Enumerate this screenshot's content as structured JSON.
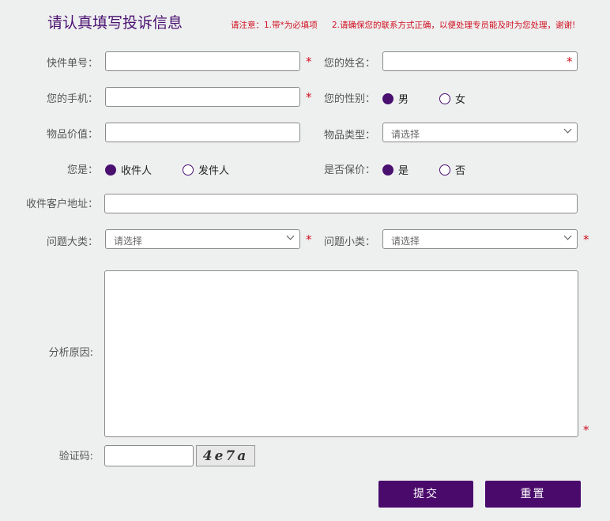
{
  "form": {
    "title": "请认真填写投诉信息",
    "notice1": "请注意：1.带*为必填项",
    "notice2": "2.请确保您的联系方式正确，以便处理专员能及时为您处理，谢谢!",
    "required_mark": "*",
    "fields": {
      "tracking_label": "快件单号：",
      "name_label": "您的姓名：",
      "phone_label": "您的手机：",
      "gender_label": "您的性别：",
      "gender_male": "男",
      "gender_female": "女",
      "gender_selected": "男",
      "value_label": "物品价值：",
      "type_label": "物品类型：",
      "type_value": "请选择",
      "role_label": "您是：",
      "role_receiver": "收件人",
      "role_sender": "发件人",
      "role_selected": "收件人",
      "insured_label": "是否保价：",
      "insured_yes": "是",
      "insured_no": "否",
      "insured_selected": "是",
      "address_label": "收件客户地址：",
      "issue_major_label": "问题大类：",
      "issue_major_value": "请选择",
      "issue_minor_label": "问题小类：",
      "issue_minor_value": "请选择",
      "reason_label": "分析原因:",
      "captcha_label": "验证码:",
      "captcha_text": "4e7a"
    },
    "buttons": {
      "submit": "提交",
      "reset": "重置"
    }
  },
  "colors": {
    "accent": "#4a0a6c",
    "required": "#d01020",
    "background": "#eef0f0"
  }
}
